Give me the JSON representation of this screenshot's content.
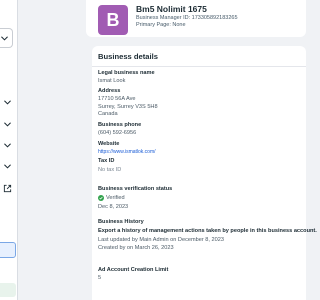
{
  "sidebar": {
    "caret_icon": "chevron-down-icon",
    "external_icon": "external-link-icon"
  },
  "header": {
    "avatar_letter": "B",
    "business_name": "Bm5 Nolimit 1675",
    "manager_id": "Business Manager ID: 173305892183265",
    "primary_page": "Primary Page: None",
    "avatar_color": "#a15cb3"
  },
  "details": {
    "title": "Business details",
    "legal_name_label": "Legal business name",
    "legal_name_value": "Ismat Look",
    "address_label": "Address",
    "address_lines": [
      "17710 56A Ave",
      "Surrey, Surrey V3S 5H8",
      "Canada"
    ],
    "phone_label": "Business phone",
    "phone_value": "(604) 592-6956",
    "website_label": "Website",
    "website_value": "https://www.ismatlok.com/",
    "tax_label": "Tax ID",
    "tax_value": "No tax ID",
    "verification_label": "Business verification status",
    "verification_value": "Verified",
    "verification_date": "Dec 8, 2023",
    "history_label": "Business History",
    "history_link": "Export a history of management actions taken by people in this business account.",
    "last_updated": "Last updated by Main Admin on December 8, 2023",
    "created_on": "Created by on March 26, 2023",
    "ad_limit_label": "Ad Account Creation Limit",
    "ad_limit_value": "5",
    "verified_color": "#31a24c",
    "link_color": "#1a5cd6"
  }
}
